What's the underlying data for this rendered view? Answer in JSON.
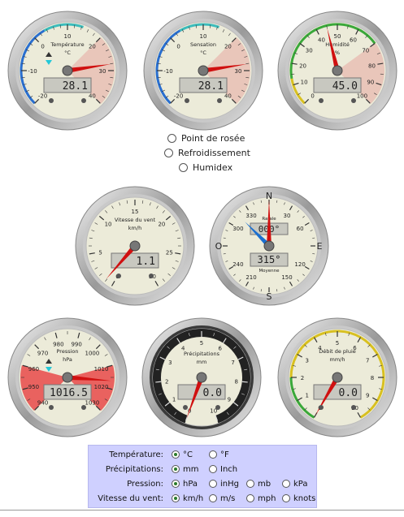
{
  "gauges": {
    "temperature": {
      "title": "Température",
      "unit": "°C",
      "ticks": [
        "-20",
        "-10",
        "0",
        "10",
        "20",
        "30",
        "40"
      ],
      "value": "28.1",
      "needle_value": 28.1
    },
    "sensation": {
      "title": "Sensation",
      "unit": "°C",
      "ticks": [
        "-20",
        "-10",
        "0",
        "10",
        "20",
        "30",
        "40"
      ],
      "value": "28.1",
      "needle_value": 28.1
    },
    "humidity": {
      "title": "Humidité",
      "unit": "%",
      "ticks": [
        "0",
        "10",
        "20",
        "30",
        "40",
        "50",
        "60",
        "70",
        "80",
        "90",
        "100"
      ],
      "value": "45.0",
      "needle_value": 45
    },
    "wind_speed": {
      "title": "Vitesse du vent",
      "unit": "km/h",
      "ticks": [
        "0",
        "5",
        "10",
        "15",
        "20",
        "25",
        "30"
      ],
      "value": "1.1",
      "needle_value": 1.1
    },
    "wind_direction": {
      "top_label": "Rafale",
      "top_value": "000°",
      "bottom_label": "Moyenne",
      "bottom_value": "315°",
      "cardinals": [
        "N",
        "E",
        "S",
        "O"
      ],
      "ticks": [
        "30",
        "60",
        "120",
        "150",
        "210",
        "240",
        "300",
        "330"
      ]
    },
    "pressure": {
      "title": "Pression",
      "unit": "hPa",
      "ticks": [
        "940",
        "950",
        "960",
        "970",
        "980",
        "990",
        "1000",
        "1010",
        "1020",
        "1030"
      ],
      "value": "1016.5",
      "needle_value": 1016.5
    },
    "precipitation": {
      "title": "Précipitations",
      "unit": "mm",
      "ticks": [
        "0",
        "1",
        "2",
        "3",
        "4",
        "5",
        "6",
        "7",
        "8",
        "9",
        "10"
      ],
      "value": "0.0",
      "needle_value": 0
    },
    "rain_rate": {
      "title": "Débit de pluie",
      "unit": "mm/h",
      "ticks": [
        "0",
        "1",
        "2",
        "3",
        "4",
        "5",
        "6",
        "7",
        "8",
        "9",
        "10"
      ],
      "value": "0.0",
      "needle_value": 0
    }
  },
  "radios": [
    {
      "label": "Point de rosée"
    },
    {
      "label": "Refroidissement"
    },
    {
      "label": "Humidex"
    }
  ],
  "units": {
    "temperature": {
      "label": "Température:",
      "options": [
        "°C",
        "°F"
      ],
      "selected": "°C"
    },
    "precipitation": {
      "label": "Précipitations:",
      "options": [
        "mm",
        "Inch"
      ],
      "selected": "mm"
    },
    "pressure": {
      "label": "Pression:",
      "options": [
        "hPa",
        "inHg",
        "mb",
        "kPa"
      ],
      "selected": "hPa"
    },
    "wind": {
      "label": "Vitesse du vent:",
      "options": [
        "km/h",
        "m/s",
        "mph",
        "knots"
      ],
      "selected": "km/h"
    }
  },
  "colors": {
    "needle": "#d01010",
    "gust_needle": "#1a6fd0",
    "lcd": "#c8c8c0",
    "panel": "#cfd0ff"
  }
}
